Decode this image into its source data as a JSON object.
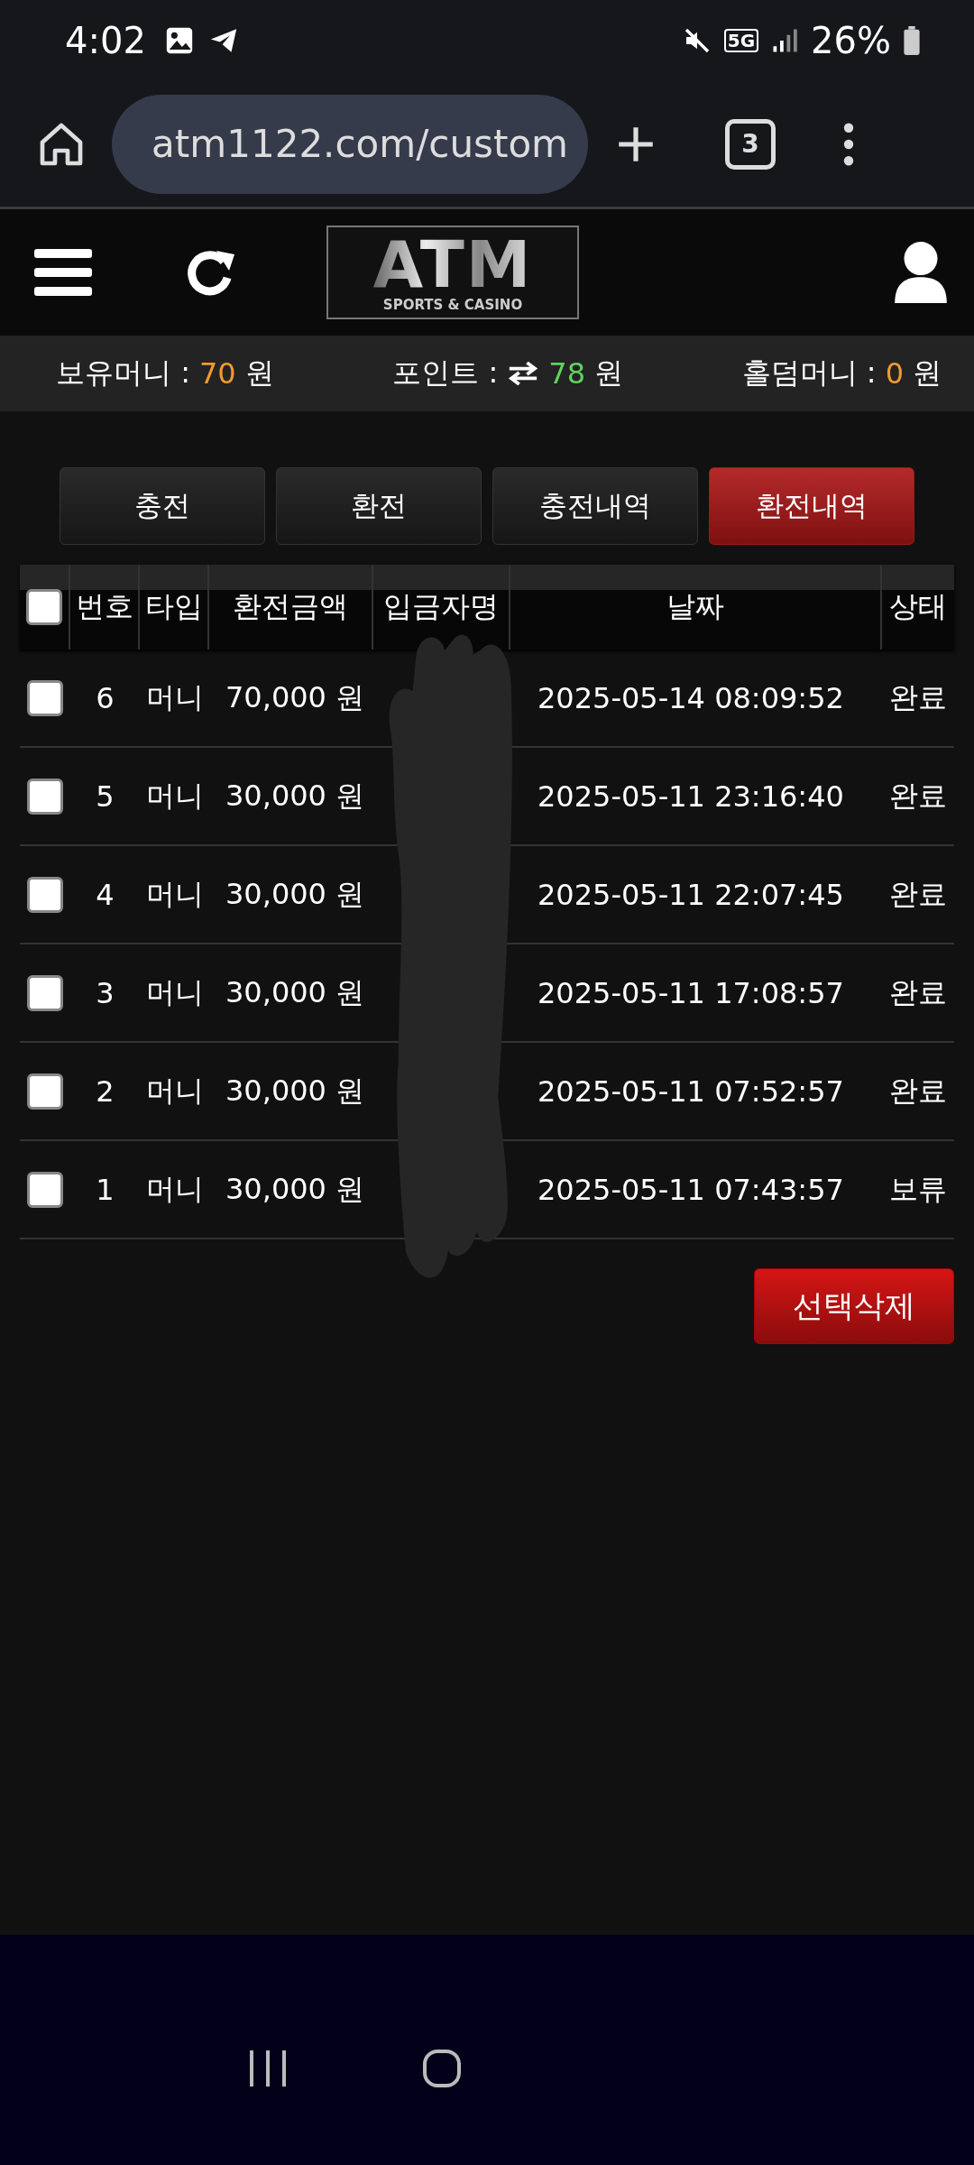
{
  "status_bar": {
    "time": "4:02",
    "network": "5G",
    "battery": "26%"
  },
  "browser": {
    "url": "atm1122.com/custom",
    "tab_count": "3"
  },
  "logo": {
    "title": "ATM",
    "subtitle": "SPORTS & CASINO"
  },
  "balances": [
    {
      "label": "보유머니 :",
      "value": "70",
      "unit": "원",
      "color": "#f39a2b",
      "kind": "plain"
    },
    {
      "label": "포인트 :",
      "value": "78",
      "unit": "원",
      "color": "#5fd35f",
      "kind": "exchange"
    },
    {
      "label": "홀덤머니 :",
      "value": "0",
      "unit": "원",
      "color": "#f39a2b",
      "kind": "plain"
    }
  ],
  "tabs": [
    {
      "label": "충전",
      "selected": false
    },
    {
      "label": "환전",
      "selected": false
    },
    {
      "label": "충전내역",
      "selected": false
    },
    {
      "label": "환전내역",
      "selected": true
    }
  ],
  "table": {
    "select_all": {
      "checked": false
    },
    "columns": [
      "번호",
      "타입",
      "환전금액",
      "입금자명",
      "날짜",
      "상태"
    ],
    "rows": [
      {
        "checked": false,
        "number": "6",
        "type": "머니",
        "amount": "70,000 원",
        "date": "2025-05-14 08:09:52",
        "status": "완료"
      },
      {
        "checked": false,
        "number": "5",
        "type": "머니",
        "amount": "30,000 원",
        "date": "2025-05-11 23:16:40",
        "status": "완료"
      },
      {
        "checked": false,
        "number": "4",
        "type": "머니",
        "amount": "30,000 원",
        "date": "2025-05-11 22:07:45",
        "status": "완료"
      },
      {
        "checked": false,
        "number": "3",
        "type": "머니",
        "amount": "30,000 원",
        "date": "2025-05-11 17:08:57",
        "status": "완료"
      },
      {
        "checked": false,
        "number": "2",
        "type": "머니",
        "amount": "30,000 원",
        "date": "2025-05-11 07:52:57",
        "status": "완료"
      },
      {
        "checked": false,
        "number": "1",
        "type": "머니",
        "amount": "30,000 원",
        "date": "2025-05-11 07:43:57",
        "status": "보류"
      }
    ]
  },
  "delete_button": "선택삭제"
}
